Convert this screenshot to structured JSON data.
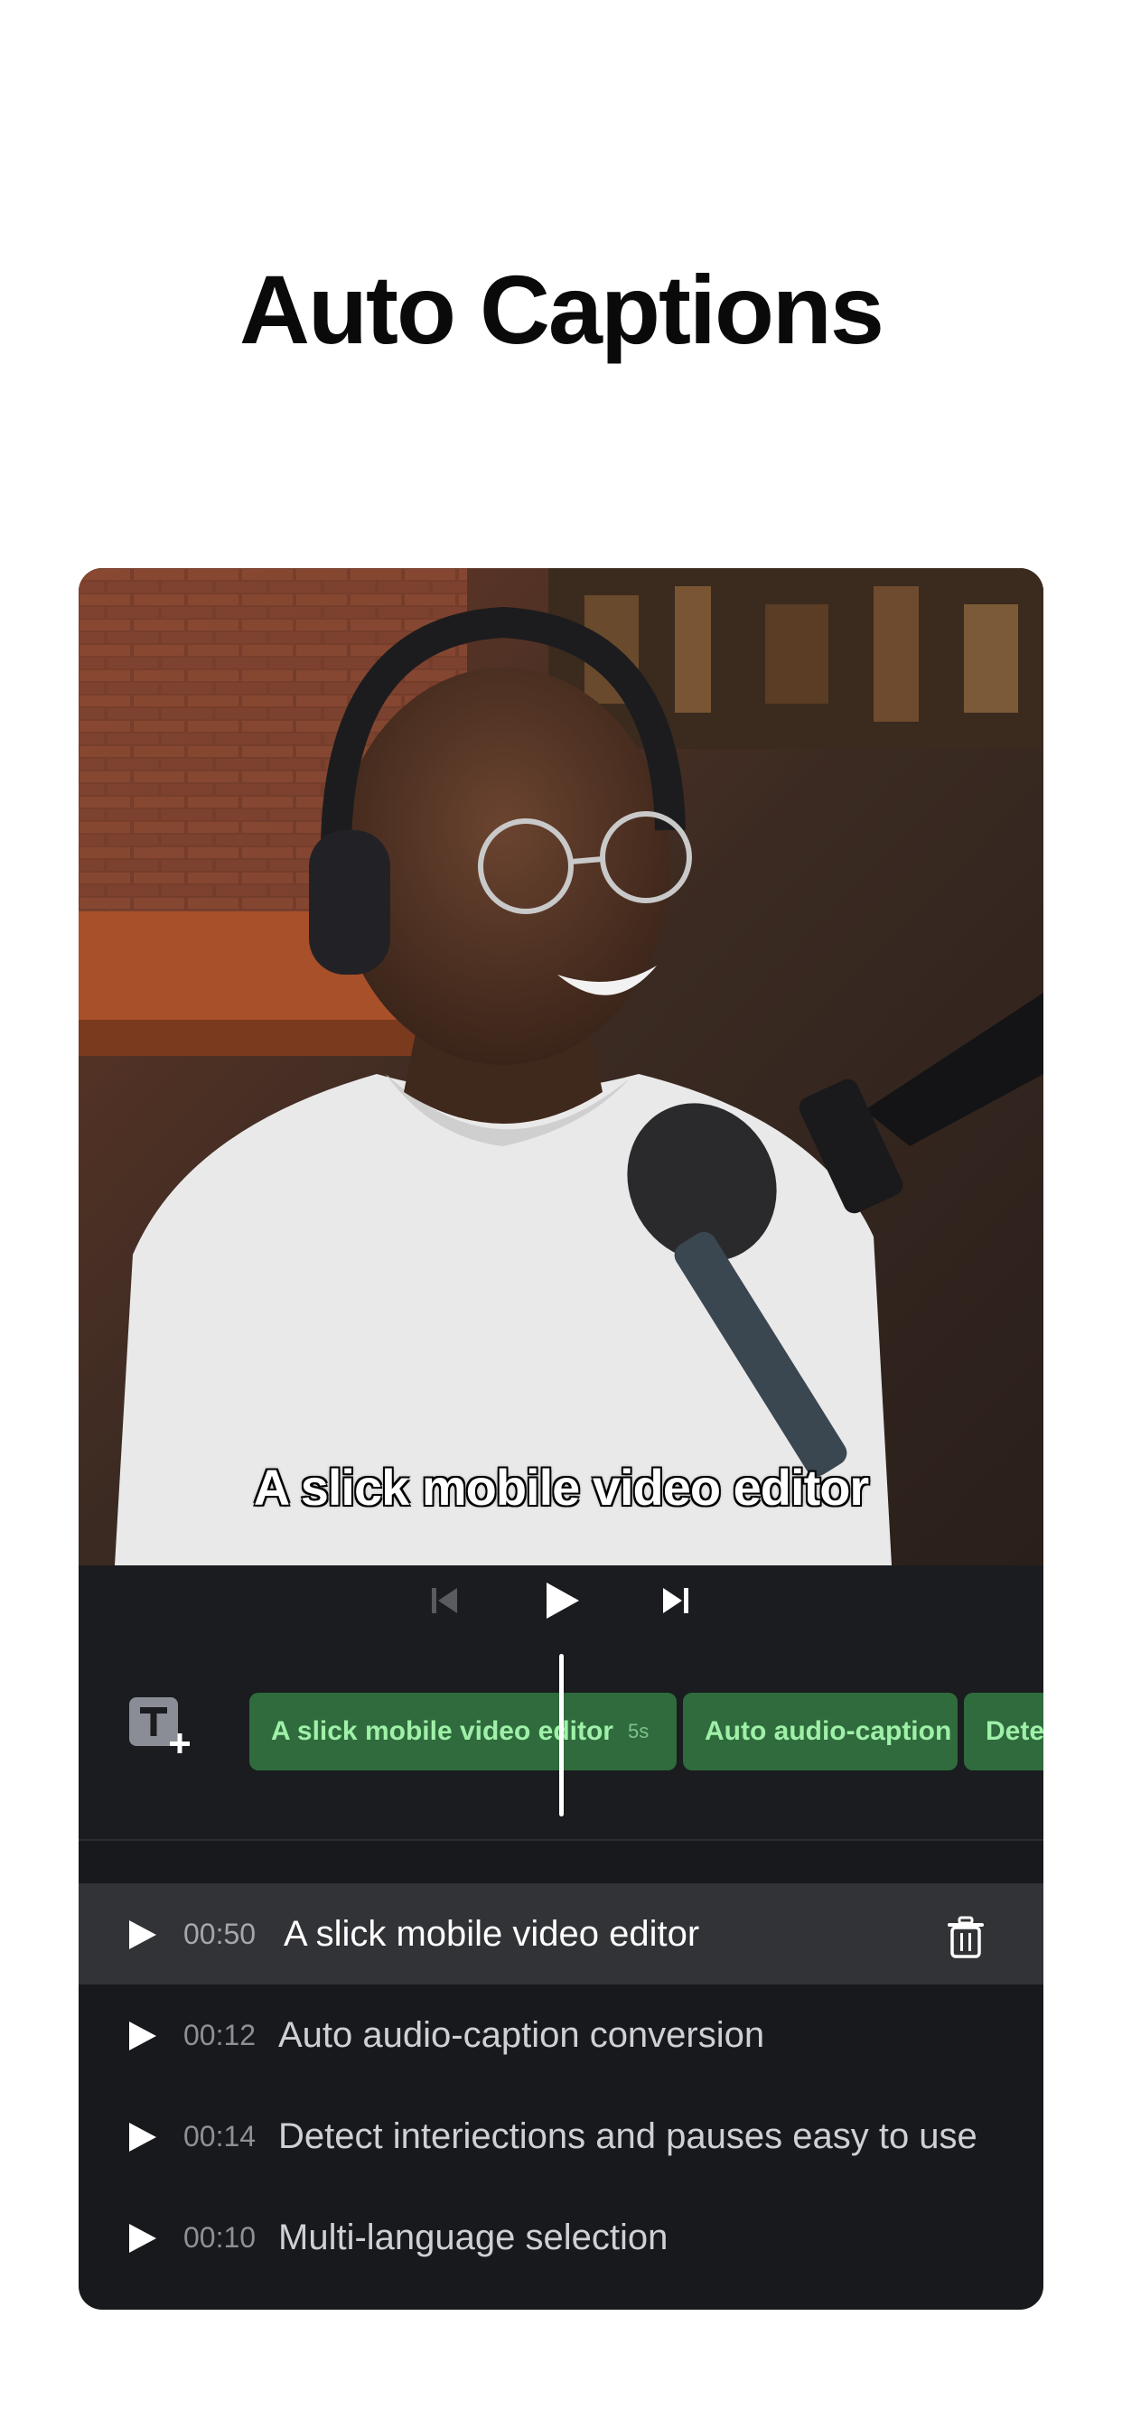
{
  "headline": "Auto Captions",
  "video": {
    "caption_overlay": "A slick mobile video editor"
  },
  "controls": {
    "prev_icon": "skip-previous-icon",
    "play_icon": "play-icon",
    "next_icon": "skip-next-icon",
    "prev_enabled": false
  },
  "timeline": {
    "add_text_icon": "add-text-icon",
    "clips": [
      {
        "label": "A slick mobile video editor",
        "duration": "5s"
      },
      {
        "label": "Auto audio-caption",
        "duration": ""
      },
      {
        "label": "Dete",
        "duration": ""
      }
    ],
    "clip_color": "#2f6b3d",
    "clip_text_color": "#9ff0a8"
  },
  "captions": [
    {
      "time": "00:50",
      "text": "A slick mobile video editor",
      "active": true
    },
    {
      "time": "00:12",
      "text": "Auto audio-caption conversion",
      "active": false
    },
    {
      "time": "00:14",
      "text": "Detect interiections and pauses easy to use",
      "active": false
    },
    {
      "time": "00:10",
      "text": "Multi-language selection",
      "active": false
    }
  ]
}
